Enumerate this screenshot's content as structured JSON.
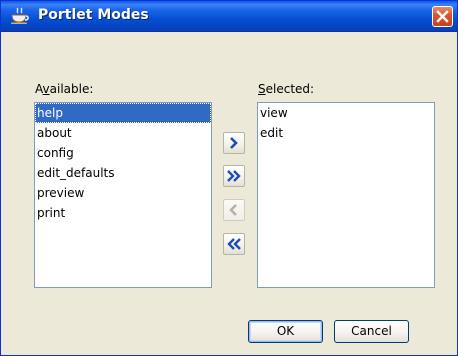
{
  "window": {
    "title": "Portlet Modes",
    "title_icon": "coffee-cup-icon",
    "close_icon": "close-icon"
  },
  "available": {
    "label_prefix": "A",
    "label_accel": "v",
    "label_suffix": "ailable:",
    "items": [
      "help",
      "about",
      "config",
      "edit_defaults",
      "preview",
      "print"
    ],
    "selected_index": 0
  },
  "selected": {
    "label_accel": "S",
    "label_suffix": "elected:",
    "items": [
      "view",
      "edit"
    ]
  },
  "transfer_buttons": {
    "add_icon": "chevron-right-icon",
    "add_all_icon": "double-chevron-right-icon",
    "remove_icon": "chevron-left-icon",
    "remove_all_icon": "double-chevron-left-icon",
    "remove_enabled": false
  },
  "actions": {
    "ok_label": "OK",
    "cancel_label": "Cancel"
  },
  "colors": {
    "titlebar": "#0A58E8",
    "selection": "#316AC5",
    "arrow": "#1C4DB8",
    "close": "#D6542F"
  }
}
